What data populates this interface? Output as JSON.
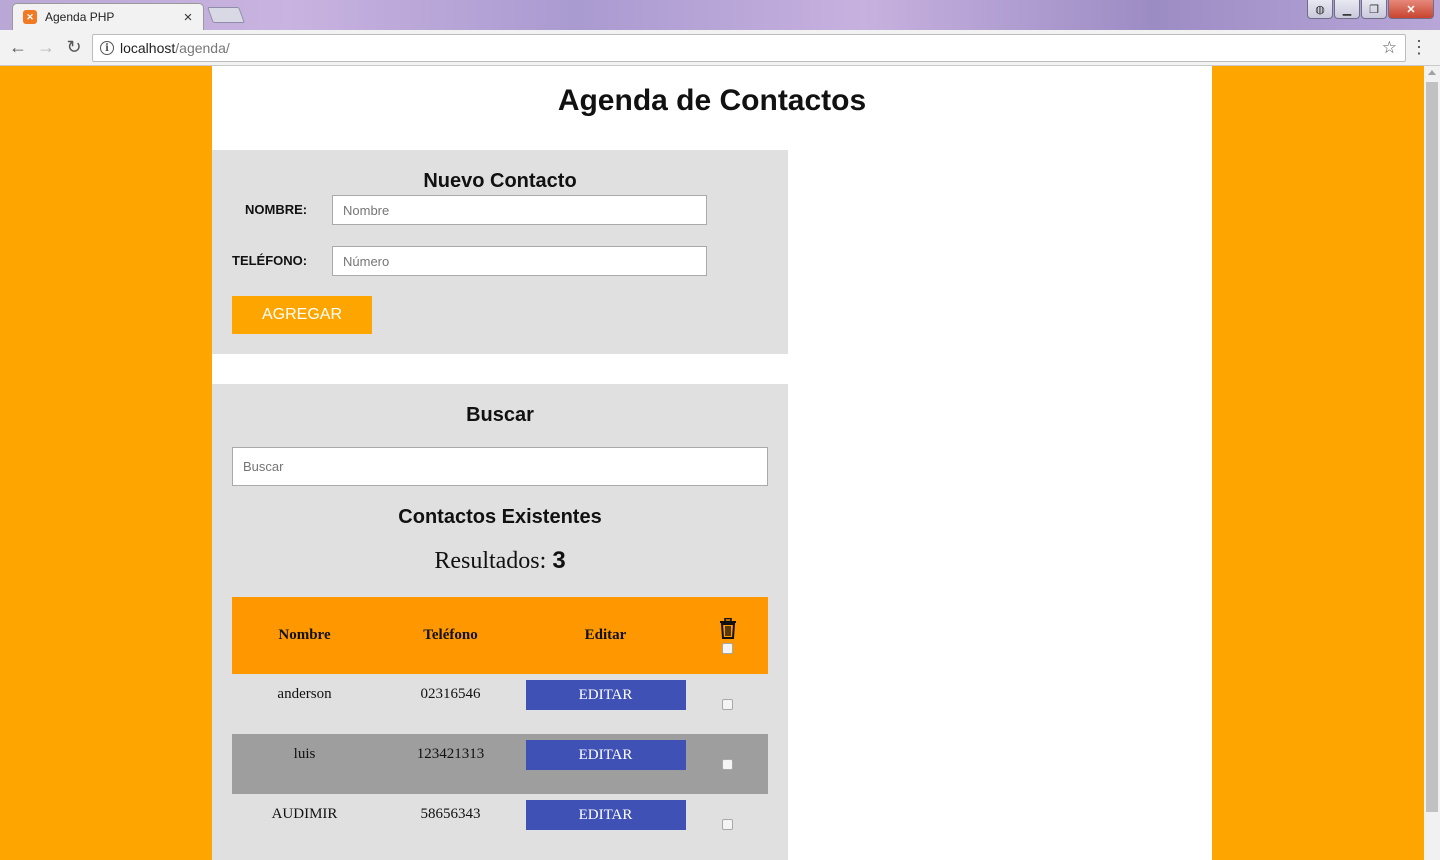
{
  "browser": {
    "tab_title": "Agenda PHP",
    "tab_close": "×",
    "url_host": "localhost",
    "url_path": "/agenda/"
  },
  "page": {
    "title": "Agenda de Contactos"
  },
  "new_contact": {
    "heading": "Nuevo Contacto",
    "nombre_label": "NOMBRE:",
    "nombre_placeholder": "Nombre",
    "telefono_label": "TELÉFONO:",
    "telefono_placeholder": "Número",
    "add_button": "AGREGAR"
  },
  "search": {
    "heading": "Buscar",
    "placeholder": "Buscar"
  },
  "contacts": {
    "heading": "Contactos Existentes",
    "results_label": "Resultados:",
    "results_count": "3",
    "columns": [
      "Nombre",
      "Teléfono",
      "Editar"
    ],
    "edit_button": "EDITAR",
    "rows": [
      {
        "nombre": "anderson",
        "telefono": "02316546"
      },
      {
        "nombre": "luis",
        "telefono": "123421313"
      },
      {
        "nombre": "AUDIMIR",
        "telefono": "58656343"
      }
    ]
  },
  "colors": {
    "page_background": "#ffa500",
    "accent": "#ffa500",
    "table_header": "#ff9800",
    "edit_button": "#3f51b5",
    "panel": "#e0e0e0",
    "alt_row": "#9e9e9e"
  },
  "icons": {
    "favicon": "xampp-icon",
    "delete_header": "trash-icon",
    "info": "info-icon",
    "bookmark": "star-icon"
  }
}
